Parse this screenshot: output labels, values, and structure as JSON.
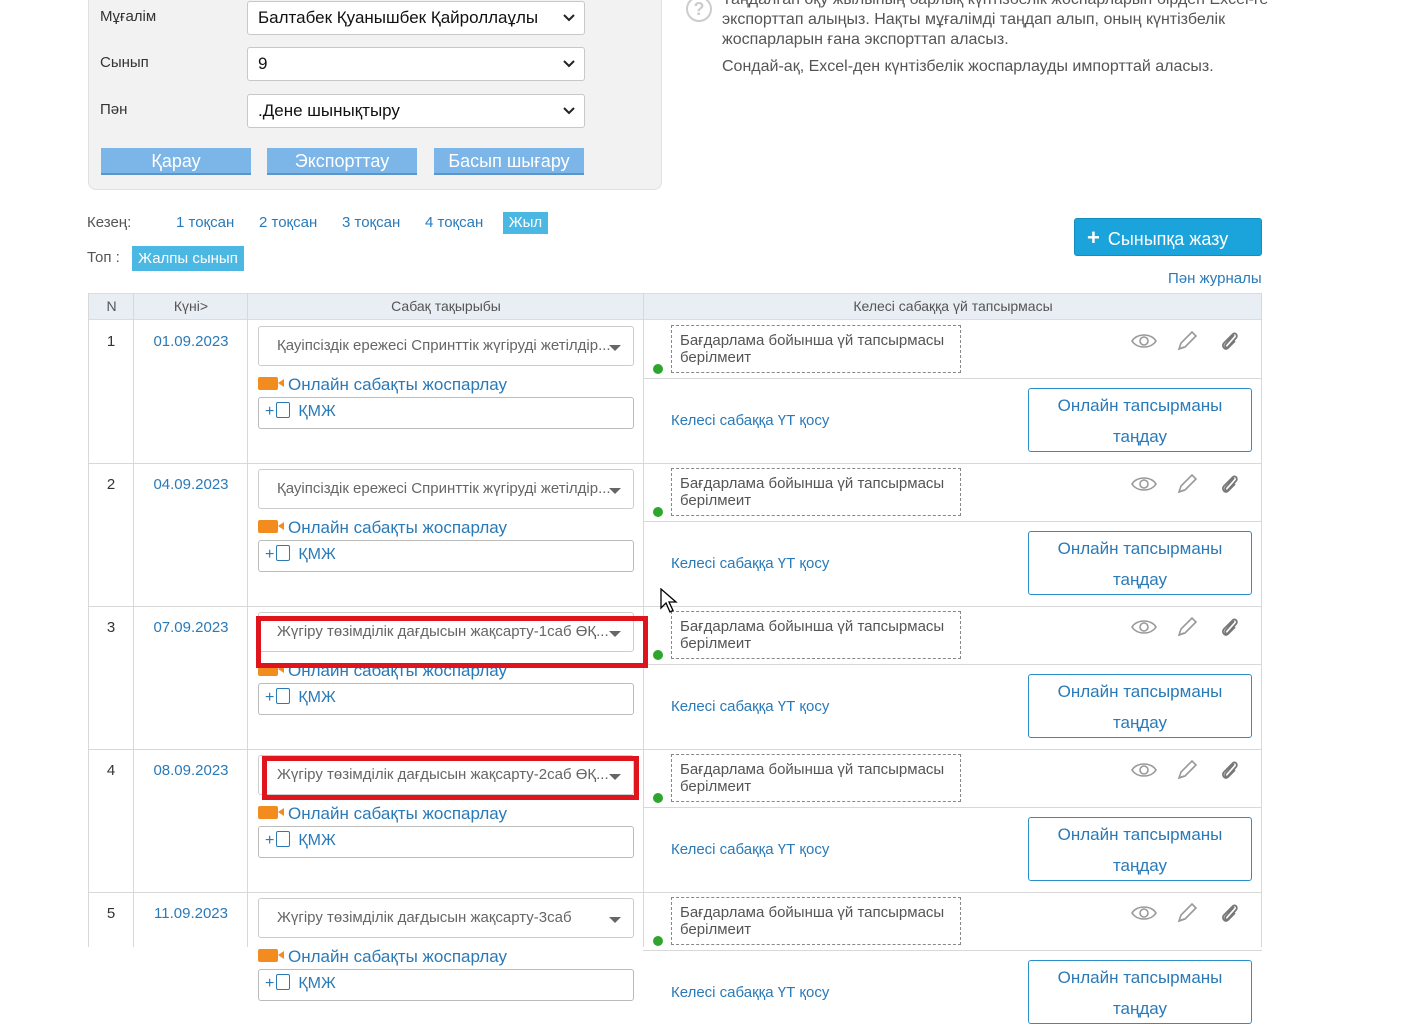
{
  "filters": {
    "teacher_label": "Мұғалім",
    "teacher_value": "Балтабек Қуанышбек Қайроллаұлы",
    "class_label": "Сынып",
    "class_value": "9",
    "subject_label": "Пән",
    "subject_value": ".Дене шынықтыру",
    "view_button": "Қарау",
    "export_button": "Экспорттау",
    "print_button": "Басып шығару"
  },
  "info": {
    "icon": "question-icon",
    "text": "Таңдалған оқу жылының барлық күнтізбелік жоспарларын бірден Excel-ге экспорттап алыңыз. Нақты мұғалімді таңдап алып, оның күнтізбелік жоспарларын ғана экспорттап аласыз.",
    "text2": "Сондай-ақ, Excel-ден күнтізбелік жоспарлауды импорттай аласыз."
  },
  "period": {
    "label": "Кезең:",
    "items": [
      "1 тоқсан",
      "2 тоқсан",
      "3 тоқсан",
      "4 тоқсан",
      "Жыл"
    ],
    "active": "Жыл"
  },
  "group": {
    "label": "Топ :",
    "active": "Жалпы сынып"
  },
  "actions": {
    "add_class_button": "Сыныпқа жазу",
    "subject_journal_link": "Пән журналы"
  },
  "table": {
    "headers": [
      "N",
      "Күні>",
      "Сабақ тақырыбы",
      "Келесі сабаққа үй тапсырмасы"
    ],
    "online_plan_label": "Онлайн сабақты жоспарлау",
    "kmzh_label": "ҚМЖ",
    "add_hw_label": "Келесі сабаққа ҮТ қосу",
    "online_task_label": "Онлайн тапсырманы таңдау",
    "rows": [
      {
        "n": "1",
        "date": "01.09.2023",
        "topic": "Қауіпсіздік ережесі Спринттік жүгіруді жетілдір...",
        "homework": "Бағдарлама бойынша үй тапсырмасы берілмеит"
      },
      {
        "n": "2",
        "date": "04.09.2023",
        "topic": "Қауіпсіздік ережесі Спринттік жүгіруді жетілдір...",
        "homework": "Бағдарлама бойынша үй тапсырмасы берілмеит"
      },
      {
        "n": "3",
        "date": "07.09.2023",
        "topic": "Жүгіру төзімділік дағдысын жақсарту-1саб ӨҚ...",
        "homework": "Бағдарлама бойынша үй тапсырмасы берілмеит"
      },
      {
        "n": "4",
        "date": "08.09.2023",
        "topic": "Жүгіру төзімділік дағдысын жақсарту-2саб ӨҚ...",
        "homework": "Бағдарлама бойынша үй тапсырмасы берілмеит"
      },
      {
        "n": "5",
        "date": "11.09.2023",
        "topic": "Жүгіру төзімділік дағдысын жақсарту-3саб",
        "homework": "Бағдарлама бойынша үй тапсырмасы берілмеит"
      }
    ]
  },
  "colors": {
    "accent": "#1aa4db",
    "link": "#2a7ab8",
    "highlight": "#e0141c",
    "status_dot": "#2ea62e",
    "camera": "#f28c1e"
  }
}
